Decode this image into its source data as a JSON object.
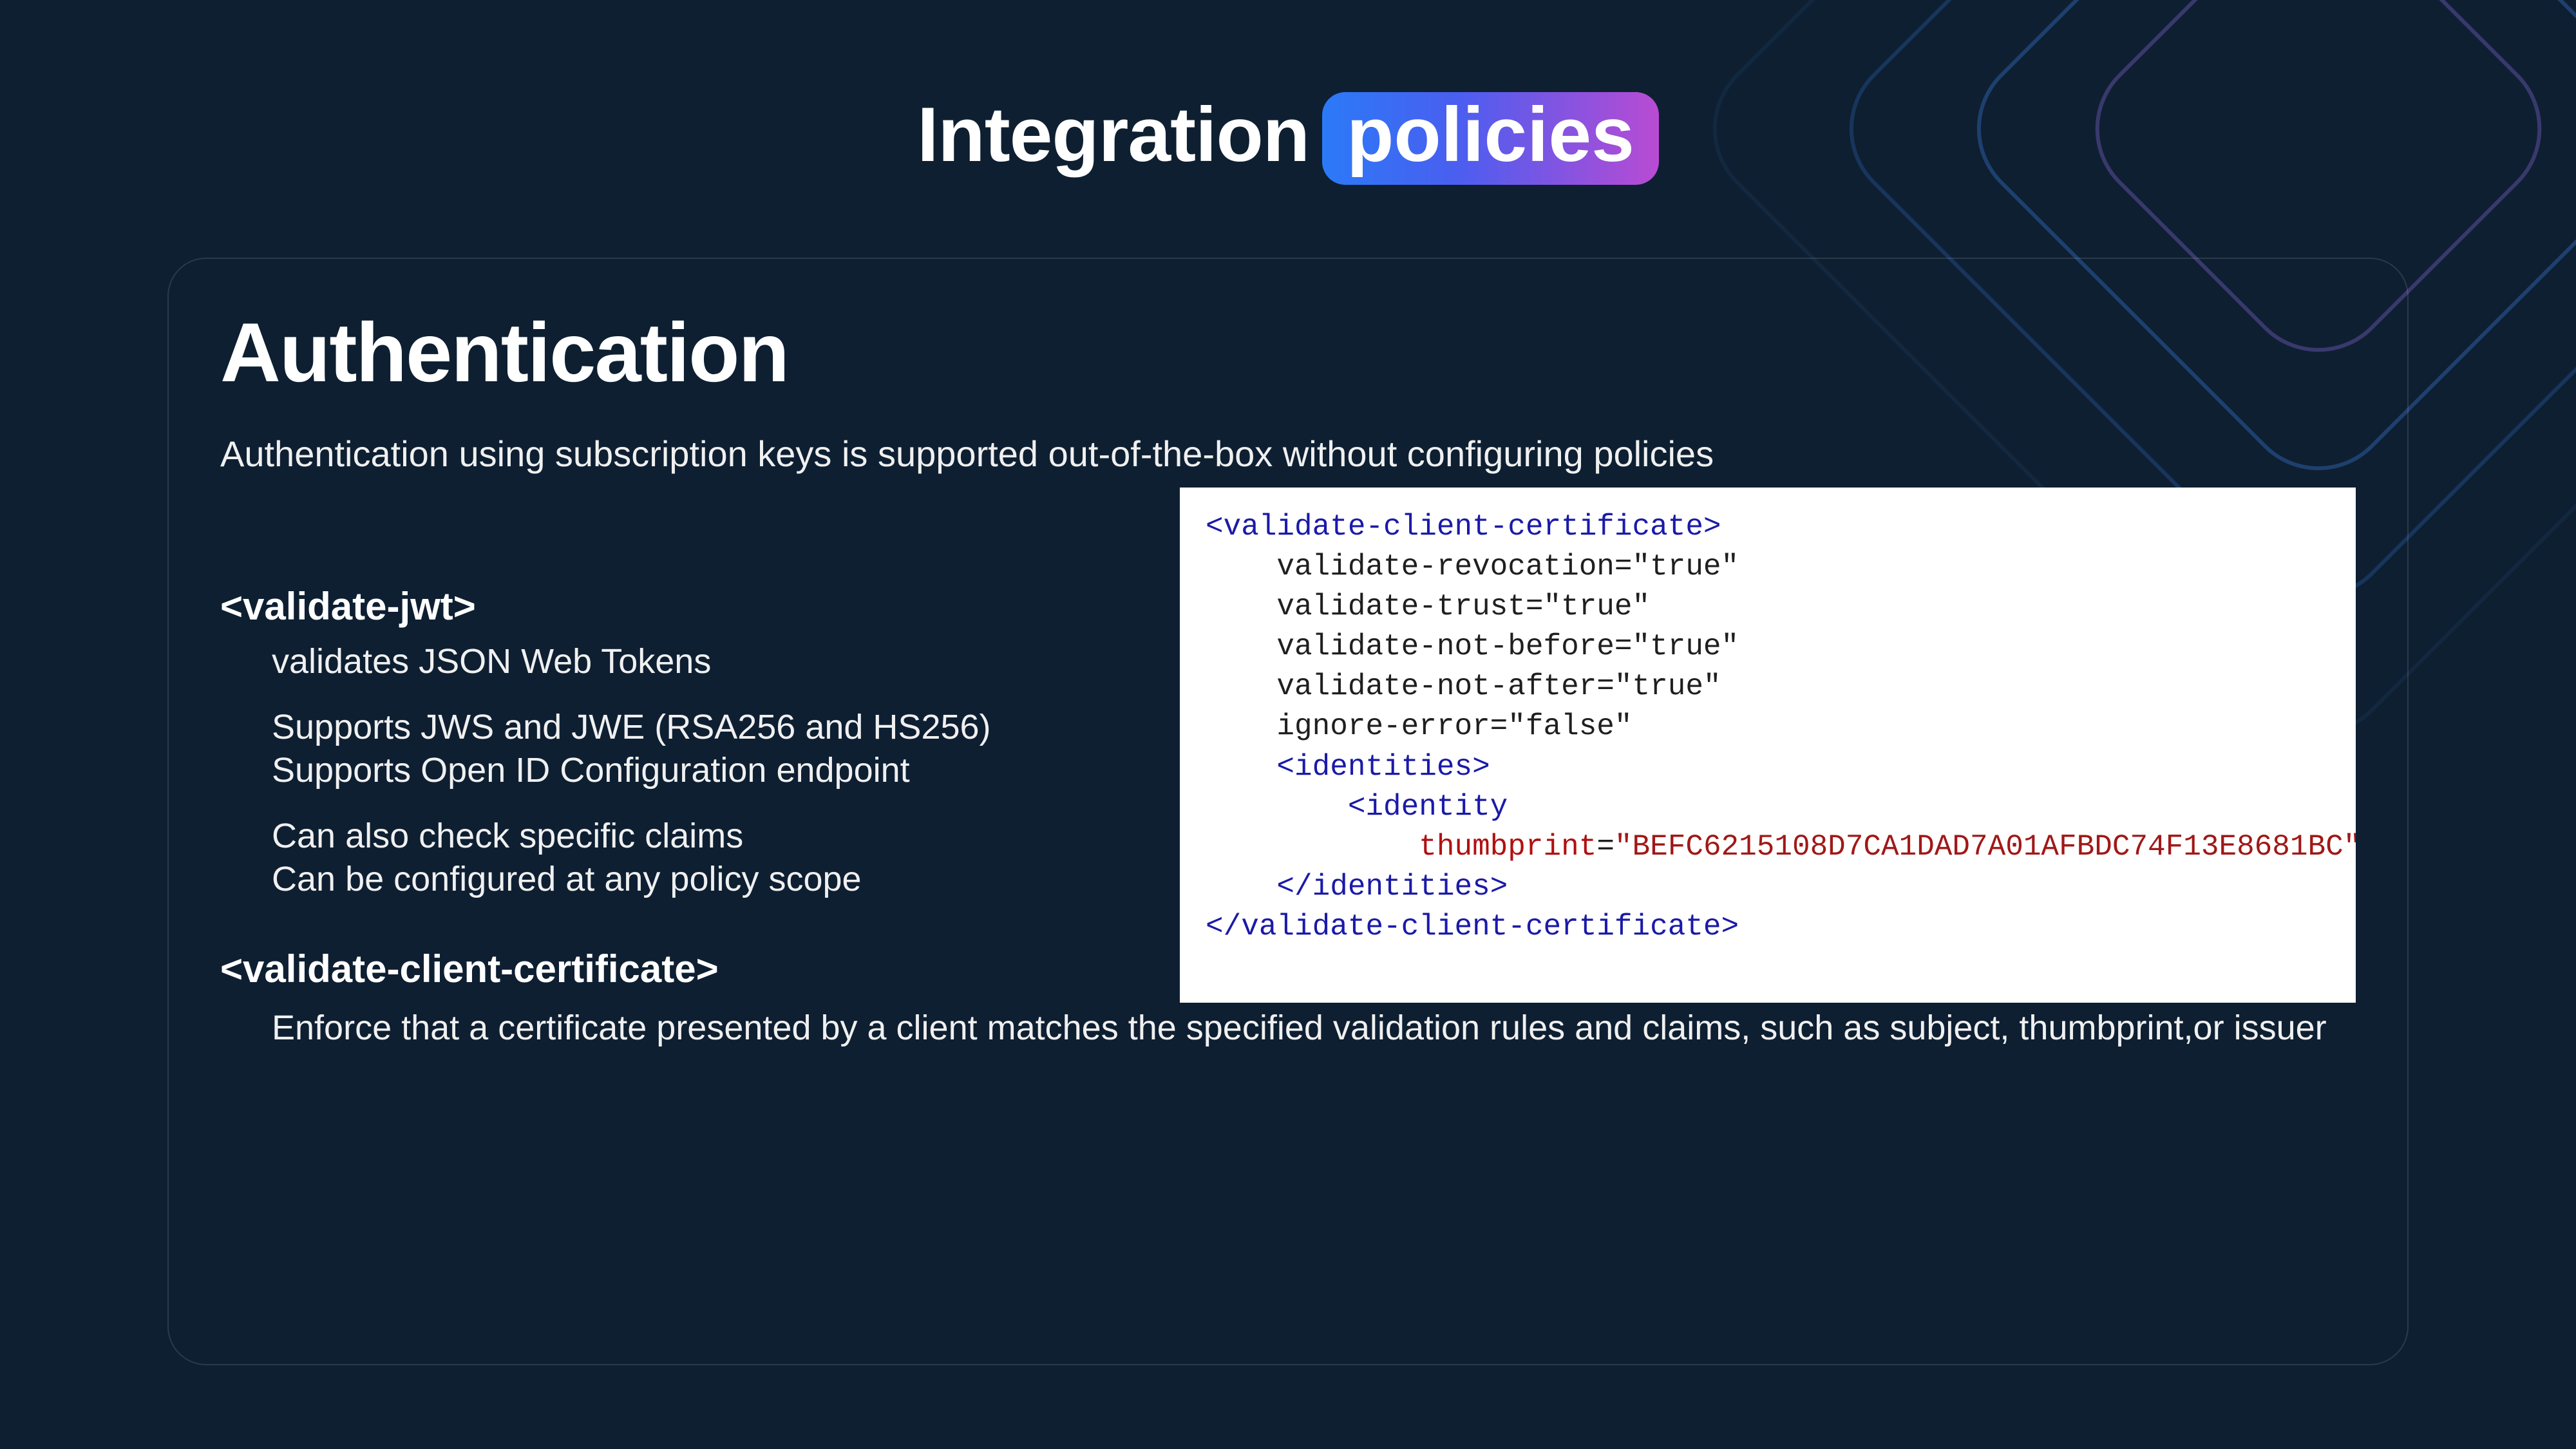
{
  "header": {
    "word1": "Integration",
    "word2": "policies"
  },
  "panel": {
    "title": "Authentication",
    "intro": "Authentication using subscription keys is supported out-of-the-box without configuring policies",
    "jwt": {
      "tag": "<validate-jwt>",
      "b1": "validates JSON Web Tokens",
      "b2a": "Supports JWS and JWE (RSA256 and HS256)",
      "b2b": "Supports Open ID Configuration endpoint",
      "b3a": "Can also check specific claims",
      "b3b": "Can be configured at any policy scope"
    },
    "cert": {
      "tag": "<validate-client-certificate>",
      "desc": "Enforce that a certificate presented by a client matches the specified validation rules and claims, such as subject, thumbprint,or issuer"
    },
    "code": {
      "l1_open": "<validate-client-certificate>",
      "l2": "validate-revocation=\"true\"",
      "l3": "validate-trust=\"true\"",
      "l4": "validate-not-before=\"true\"",
      "l5": "validate-not-after=\"true\"",
      "l6": "ignore-error=\"false\"",
      "l7": "<identities>",
      "l8": "<identity",
      "l9_attr": "thumbprint",
      "l9_val": "\"BEFC6215108D7CA1DAD7A01AFBDC74F13E8681BC\"",
      "l9_close": " />",
      "l10": "</identities>",
      "l11": "</validate-client-certificate>"
    }
  }
}
